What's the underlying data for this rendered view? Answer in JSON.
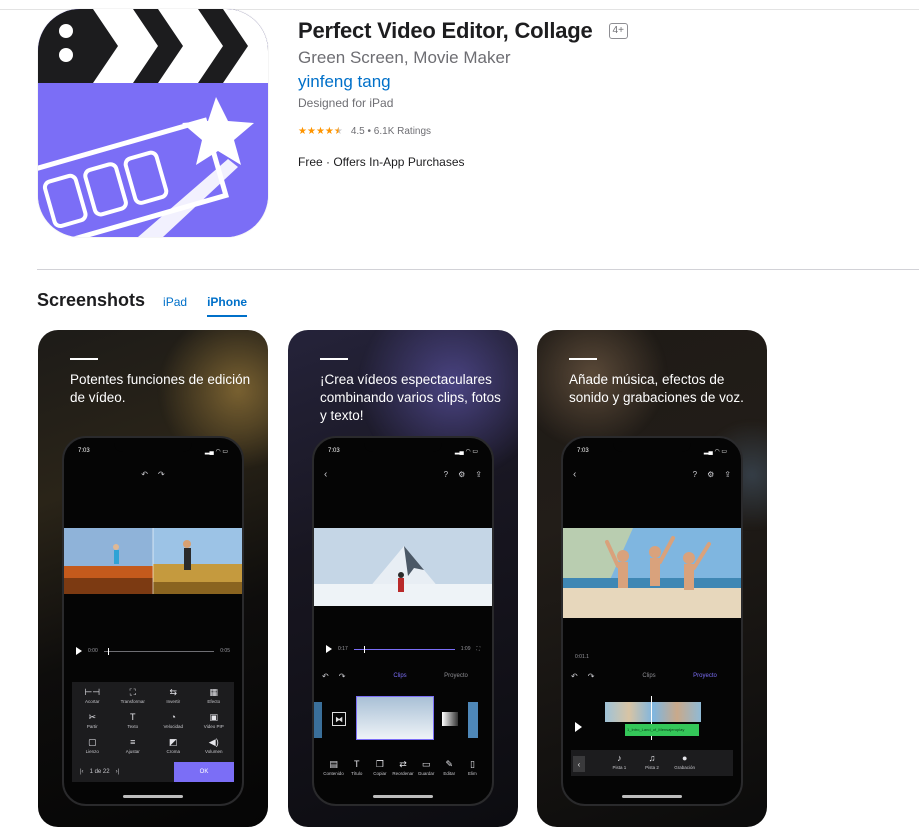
{
  "app": {
    "title": "Perfect Video Editor, Collage",
    "age_rating": "4+",
    "subtitle": "Green Screen, Movie Maker",
    "developer": "yinfeng tang",
    "designed_for": "Designed for iPad",
    "rating_value": 4.5,
    "rating_text": "4.5 • 6.1K Ratings",
    "price_text": "Free · Offers In-App Purchases",
    "icon": "clapperboard-with-film-strip-and-magic-wand-icon"
  },
  "screenshots": {
    "title": "Screenshots",
    "tabs": [
      {
        "label": "iPad",
        "active": false
      },
      {
        "label": "iPhone",
        "active": true
      }
    ],
    "items": [
      {
        "caption": "Potentes funciones de edición de vídeo.",
        "status_time": "7:03",
        "time_start": "0:00",
        "time_end": "0:05",
        "tools": [
          {
            "icon": "trim-icon",
            "glyph": "⊢⊣",
            "label": "Acortar"
          },
          {
            "icon": "transform-icon",
            "glyph": "⛶",
            "label": "Transformar"
          },
          {
            "icon": "invert-icon",
            "glyph": "⇆",
            "label": "Invertir"
          },
          {
            "icon": "effect-icon",
            "glyph": "▦",
            "label": "Efecto"
          },
          {
            "icon": "split-icon",
            "glyph": "✂",
            "label": "Partir"
          },
          {
            "icon": "text-icon",
            "glyph": "T",
            "label": "Texto"
          },
          {
            "icon": "speed-icon",
            "glyph": "◔",
            "label": "Velocidad"
          },
          {
            "icon": "pip-icon",
            "glyph": "▣",
            "label": "Video PIP"
          },
          {
            "icon": "canvas-icon",
            "glyph": "▢",
            "label": "Lienzo"
          },
          {
            "icon": "adjust-icon",
            "glyph": "≡",
            "label": "Ajustar"
          },
          {
            "icon": "chroma-icon",
            "glyph": "◩",
            "label": "Croma"
          },
          {
            "icon": "volume-icon",
            "glyph": "◀)",
            "label": "Volumen"
          }
        ],
        "pager": "1 de 22",
        "ok_label": "OK"
      },
      {
        "caption": "¡Crea vídeos espectaculares combinando varios clips, fotos y texto!",
        "status_time": "7:03",
        "time_start": "0:17",
        "time_end": "1:09",
        "tab_clips": "Clips",
        "tab_project": "Proyecto",
        "tools": [
          {
            "icon": "content-icon",
            "glyph": "▤",
            "label": "Contenido"
          },
          {
            "icon": "title-icon",
            "glyph": "T",
            "label": "Título"
          },
          {
            "icon": "copy-icon",
            "glyph": "❐",
            "label": "Copiar"
          },
          {
            "icon": "reorder-icon",
            "glyph": "⇄",
            "label": "Reordenar"
          },
          {
            "icon": "save-icon",
            "glyph": "▭",
            "label": "Guardar"
          },
          {
            "icon": "edit-icon",
            "glyph": "✎",
            "label": "Editar"
          },
          {
            "icon": "delete-icon",
            "glyph": "▯",
            "label": "Elim"
          }
        ]
      },
      {
        "caption": "Añade música, efectos de sonido y grabaciones de voz.",
        "status_time": "7:03",
        "time_code": "0:01.1",
        "tab_clips": "Clips",
        "tab_project": "Proyecto",
        "audio_clip_label": "1_Intro_Land_of_Mensajeroplay",
        "tools": [
          {
            "icon": "track1-icon",
            "glyph": "♪",
            "label": "Pista 1"
          },
          {
            "icon": "track2-icon",
            "glyph": "♫",
            "label": "Pista 2"
          },
          {
            "icon": "microphone-icon",
            "glyph": "🎙",
            "label": "Grabación"
          }
        ]
      }
    ]
  },
  "colors": {
    "link": "#0070c9",
    "accent_purple": "#7b6ef6",
    "star": "#ff9500"
  }
}
